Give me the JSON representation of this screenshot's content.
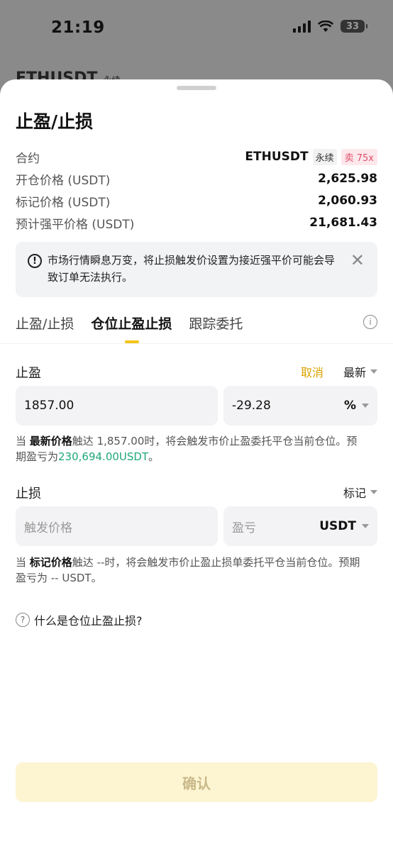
{
  "status_bar": {
    "time": "21:19",
    "battery": "33"
  },
  "background": {
    "symbol": "ETHUSDT",
    "type": "永续"
  },
  "sheet": {
    "title": "止盈/止损",
    "contract_label": "合约",
    "contract_value": "ETHUSDT",
    "contract_type": "永续",
    "contract_side": "卖 75x",
    "rows": [
      {
        "label": "开仓价格 (USDT)",
        "value": "2,625.98"
      },
      {
        "label": "标记价格 (USDT)",
        "value": "2,060.93"
      },
      {
        "label": "预计强平价格 (USDT)",
        "value": "21,681.43"
      }
    ],
    "warning": "市场行情瞬息万变，将止损触发价设置为接近强平价可能会导致订单无法执行。",
    "tabs": [
      {
        "label": "止盈/止损"
      },
      {
        "label": "仓位止盈止损"
      },
      {
        "label": "跟踪委托"
      }
    ],
    "take_profit": {
      "title": "止盈",
      "cancel": "取消",
      "price_type": "最新",
      "price_value": "1857.00",
      "pnl_value": "-29.28",
      "pnl_unit": "%",
      "desc_prefix": "当 ",
      "desc_bold": "最新价格",
      "desc_mid": "触达 1,857.00时，将会触发市价止盈委托平仓当前仓位。预期盈亏为",
      "desc_amount": "230,694.00USDT",
      "desc_end": "。"
    },
    "stop_loss": {
      "title": "止损",
      "price_type": "标记",
      "price_placeholder": "触发价格",
      "pnl_placeholder": "盈亏",
      "pnl_unit": "USDT",
      "desc_prefix": "当 ",
      "desc_bold": "标记价格",
      "desc_rest": "触达 --时，将会触发市价止盈止损单委托平仓当前仓位。预期盈亏为 -- USDT。"
    },
    "help_text": "什么是仓位止盈止损?",
    "confirm": "确认"
  },
  "colors": {
    "accent": "#f5c518",
    "profit": "#1fa876",
    "sell_tag": "#e0506a"
  }
}
